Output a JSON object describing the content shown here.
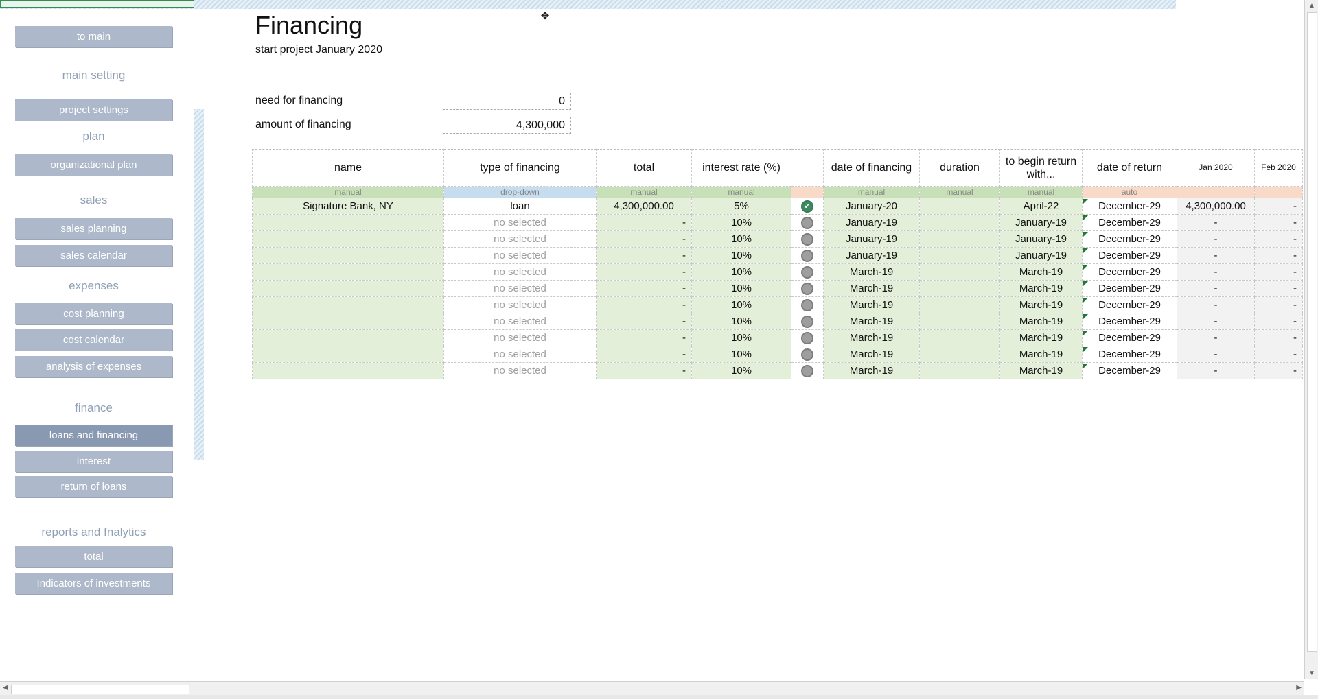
{
  "sidebar": {
    "to_main": "to main",
    "main_setting": "main setting",
    "project_settings": "project settings",
    "plan": "plan",
    "organizational_plan": "organizational plan",
    "sales": "sales",
    "sales_planning": "sales planning",
    "sales_calendar": "sales calendar",
    "expenses": "expenses",
    "cost_planning": "cost planning",
    "cost_calendar": "cost calendar",
    "analysis_of_expenses": "analysis of expenses",
    "finance": "finance",
    "loans_and_financing": "loans and financing",
    "interest": "interest",
    "return_of_loans": "return of loans",
    "reports": "reports and fnalytics",
    "total": "total",
    "indicators": "Indicators of investments"
  },
  "header": {
    "title": "Financing",
    "subtitle": "start project January 2020",
    "need_label": "need for financing",
    "need_value": "0",
    "amount_label": "amount of financing",
    "amount_value": "4,300,000"
  },
  "table": {
    "columns": {
      "name": "name",
      "type": "type of financing",
      "total": "total",
      "rate": "interest rate (%)",
      "date_fin": "date of financing",
      "duration": "duration",
      "begin_return": "to begin return with...",
      "date_return": "date of return",
      "jan2020": "Jan 2020",
      "feb2020": "Feb 2020"
    },
    "hints": {
      "name": "manual",
      "type": "drop-down",
      "total": "manual",
      "rate": "manual",
      "date_fin": "manual",
      "duration": "manual",
      "begin_return": "manual",
      "date_return": "auto"
    },
    "rows": [
      {
        "name": "Signature Bank, NY",
        "type": "loan",
        "total": "4,300,000.00",
        "rate": "5%",
        "date_fin": "January-20",
        "duration": "",
        "begin": "April-22",
        "ret": "December-29",
        "jan": "4,300,000.00",
        "feb": "-"
      },
      {
        "name": "",
        "type": "no selected",
        "total": "-",
        "rate": "10%",
        "date_fin": "January-19",
        "duration": "",
        "begin": "January-19",
        "ret": "December-29",
        "jan": "-",
        "feb": "-"
      },
      {
        "name": "",
        "type": "no selected",
        "total": "-",
        "rate": "10%",
        "date_fin": "January-19",
        "duration": "",
        "begin": "January-19",
        "ret": "December-29",
        "jan": "-",
        "feb": "-"
      },
      {
        "name": "",
        "type": "no selected",
        "total": "-",
        "rate": "10%",
        "date_fin": "January-19",
        "duration": "",
        "begin": "January-19",
        "ret": "December-29",
        "jan": "-",
        "feb": "-"
      },
      {
        "name": "",
        "type": "no selected",
        "total": "-",
        "rate": "10%",
        "date_fin": "March-19",
        "duration": "",
        "begin": "March-19",
        "ret": "December-29",
        "jan": "-",
        "feb": "-"
      },
      {
        "name": "",
        "type": "no selected",
        "total": "-",
        "rate": "10%",
        "date_fin": "March-19",
        "duration": "",
        "begin": "March-19",
        "ret": "December-29",
        "jan": "-",
        "feb": "-"
      },
      {
        "name": "",
        "type": "no selected",
        "total": "-",
        "rate": "10%",
        "date_fin": "March-19",
        "duration": "",
        "begin": "March-19",
        "ret": "December-29",
        "jan": "-",
        "feb": "-"
      },
      {
        "name": "",
        "type": "no selected",
        "total": "-",
        "rate": "10%",
        "date_fin": "March-19",
        "duration": "",
        "begin": "March-19",
        "ret": "December-29",
        "jan": "-",
        "feb": "-"
      },
      {
        "name": "",
        "type": "no selected",
        "total": "-",
        "rate": "10%",
        "date_fin": "March-19",
        "duration": "",
        "begin": "March-19",
        "ret": "December-29",
        "jan": "-",
        "feb": "-"
      },
      {
        "name": "",
        "type": "no selected",
        "total": "-",
        "rate": "10%",
        "date_fin": "March-19",
        "duration": "",
        "begin": "March-19",
        "ret": "December-29",
        "jan": "-",
        "feb": "-"
      },
      {
        "name": "",
        "type": "no selected",
        "total": "-",
        "rate": "10%",
        "date_fin": "March-19",
        "duration": "",
        "begin": "March-19",
        "ret": "December-29",
        "jan": "-",
        "feb": "-"
      }
    ]
  }
}
